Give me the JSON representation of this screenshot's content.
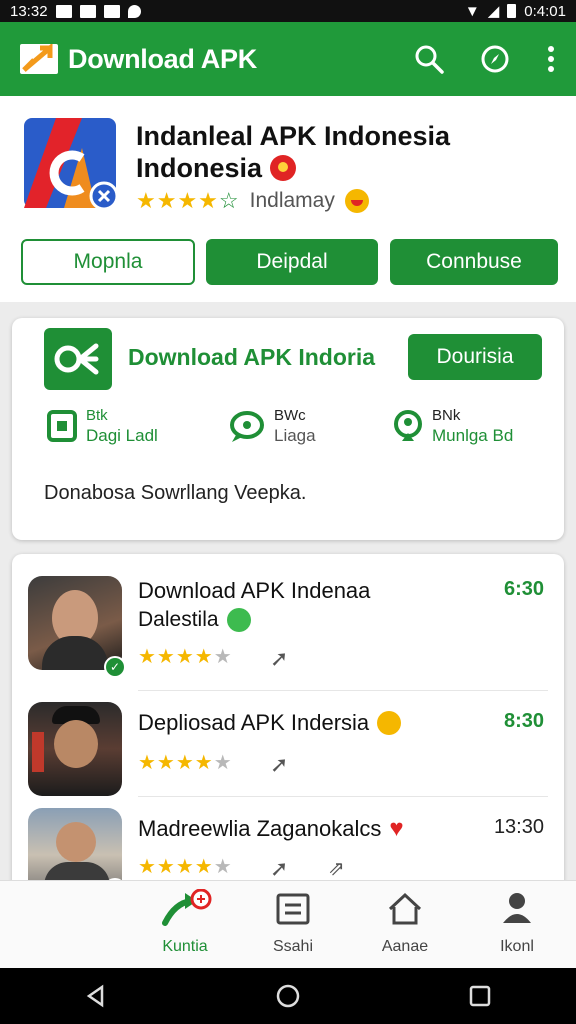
{
  "status_bar": {
    "time": "13:32",
    "right_text": "0:4:01"
  },
  "app_bar": {
    "title": "Download APK"
  },
  "app_header": {
    "name_line1": "Indanleal APK Indonesia",
    "name_line2": "Indonesia",
    "rating_text": "Indlamay",
    "buttons": {
      "outline": "Mopnla",
      "middle": "Deipdal",
      "right": "Connbuse"
    }
  },
  "promo": {
    "title": "Download APK Indoria",
    "button": "Dourisia",
    "features": [
      {
        "line1": "Btk",
        "line2": "Dagi Ladl"
      },
      {
        "line1": "BWc",
        "line2": "Liaga"
      },
      {
        "line1": "BNk",
        "line2": "Munlga Bd"
      }
    ],
    "description": "Donabosa Sowrllang Veepka."
  },
  "list": [
    {
      "title": "Download APK Indenaa",
      "subtitle": "Dalestila",
      "time": "6:30",
      "stars": 4
    },
    {
      "title": "Depliosad APK Indersia",
      "subtitle": "",
      "time": "8:30",
      "stars": 4
    },
    {
      "title": "Madreewlia Zaganokalcs",
      "subtitle": "",
      "time": "13:30",
      "stars": 4
    }
  ],
  "bottom_nav": [
    {
      "label": "Kuntia",
      "icon": "download-icon"
    },
    {
      "label": "Ssahi",
      "icon": "list-icon"
    },
    {
      "label": "Aanae",
      "icon": "home-icon"
    },
    {
      "label": "Ikonl",
      "icon": "profile-icon"
    }
  ],
  "colors": {
    "primary": "#209a3a",
    "star": "#f5b700",
    "accent": "#e02424"
  }
}
